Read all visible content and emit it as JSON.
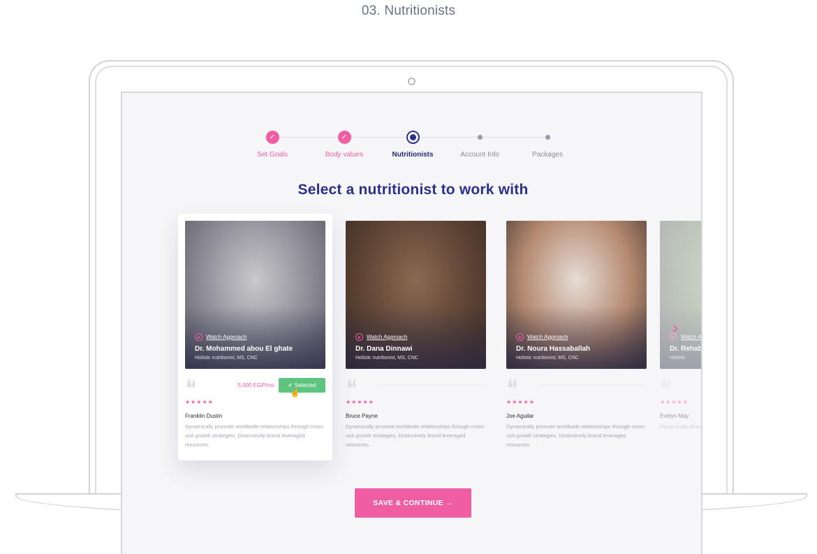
{
  "caption": "03. Nutritionists",
  "stepper": {
    "steps": [
      {
        "label": "Set Goals",
        "state": "done"
      },
      {
        "label": "Body values",
        "state": "done"
      },
      {
        "label": "Nutritionists",
        "state": "active"
      },
      {
        "label": "Account Info",
        "state": "todo"
      },
      {
        "label": "Packages",
        "state": "todo"
      }
    ],
    "check_glyph": "✓"
  },
  "headline": "Select a nutritionist to work with",
  "cards": [
    {
      "watch_label": "Watch Approach",
      "name": "Dr. Mohammed abou El ghate",
      "title": "Holistic nutritionist, MS, CNC",
      "price": "5,000 EGP/mo",
      "selected_label": "✔ Selected",
      "stars": "★★★★★",
      "reviewer": "Franklin Dustin",
      "review": "Dynamically promote worldwide relationships through cross-unit growth strategies. Distinctively brand leveraged resources.",
      "photo_colors": [
        "#c9c8cc",
        "#8e8d96",
        "#5b5a66"
      ]
    },
    {
      "watch_label": "Watch Approach",
      "name": "Dr. Dana Dinnawi",
      "title": "Holistic nutritionist, MS, CNC",
      "stars": "★★★★★",
      "reviewer": "Bruce Payne",
      "review": "Dynamically promote worldwide relationships through cross-unit growth strategies. Distinctively brand leveraged resources.",
      "photo_colors": [
        "#8a6a52",
        "#5e4434",
        "#3a2b24"
      ]
    },
    {
      "watch_label": "Watch Approach",
      "name": "Dr. Noura Hassaballah",
      "title": "Holistic nutritionist, MS, CNC",
      "stars": "★★★★★",
      "reviewer": "Joe Aguilar",
      "review": "Dynamically promote worldwide relationships through cross-unit growth strategies. Distinctively brand leveraged resources.",
      "photo_colors": [
        "#e6dcd6",
        "#b58a70",
        "#4a3a36"
      ]
    },
    {
      "watch_label": "Watch A",
      "name": "Dr. Rehab",
      "title": "Holistic",
      "stars": "★★★★★",
      "reviewer": "Evelyn May",
      "review": "Dynamically through cr Distinctively",
      "photo_colors": [
        "#a8b89a",
        "#7a8c6e",
        "#5a5a5c"
      ]
    }
  ],
  "cta_label": "SAVE & CONTINUE →",
  "colors": {
    "accent": "#ef5ea3",
    "primary": "#2a318a",
    "success": "#5ec47f"
  }
}
